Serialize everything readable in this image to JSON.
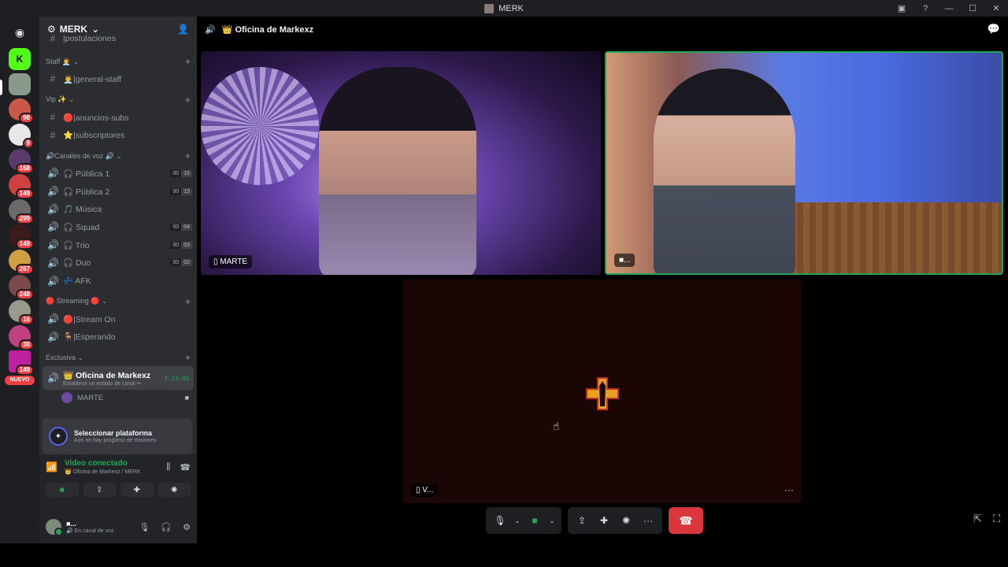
{
  "window": {
    "title": "MERK"
  },
  "server_rail": {
    "badges": [
      "98",
      "9",
      "168",
      "149",
      "299",
      "149",
      "267",
      "248",
      "16",
      "30",
      "149"
    ],
    "new_label": "NUEVO"
  },
  "guild": {
    "name": "MERK"
  },
  "channels": {
    "partial_top": "|postulaciones",
    "categories": [
      {
        "name": "Staff 👨‍💼",
        "channels": [
          {
            "icon": "#",
            "label": "👨‍💼|general-staff"
          }
        ]
      },
      {
        "name": "Vip ✨",
        "channels": [
          {
            "icon": "#",
            "label": "🔴|anuncios-subs"
          },
          {
            "icon": "#",
            "label": "⭐|subscriptores"
          }
        ]
      },
      {
        "name": "🔊Canales de voz 🔊"
      },
      {
        "name": "🔴 Streaming 🔴"
      },
      {
        "name": "Exclusiva"
      }
    ],
    "voice": [
      {
        "label": "🎧 Pública 1",
        "a": "00",
        "b": "15"
      },
      {
        "label": "🎧 Pública 2",
        "a": "00",
        "b": "15"
      },
      {
        "label": "🎵 Música"
      },
      {
        "label": "🎧 Squad",
        "a": "00",
        "b": "04"
      },
      {
        "label": "🎧 Trio",
        "a": "00",
        "b": "03"
      },
      {
        "label": "🎧 Duo",
        "a": "00",
        "b": "02"
      },
      {
        "label": "💤 AFK"
      }
    ],
    "streaming": [
      {
        "label": "🔴|Stream On"
      },
      {
        "label": "🪑|Esperando"
      }
    ],
    "active": {
      "label": "👑 Oficina de Markexz",
      "status": "Establece un estado de canal ✏",
      "timer": "3:33:45"
    },
    "voice_member": "MARTE"
  },
  "quest": {
    "title": "Seleccionar plataforma",
    "subtitle": "Aún no hay progreso de misiones"
  },
  "voice_connection": {
    "status": "Video conectado",
    "location": "👑 Oficina de Markexz / MERK"
  },
  "user": {
    "name": "■...",
    "status": "🔊 En canal de voz"
  },
  "stage": {
    "channel_title": "👑 Oficina de Markexz",
    "tiles": [
      {
        "name": "MARTE"
      },
      {
        "name": "■..."
      },
      {
        "name": "V..."
      }
    ]
  }
}
